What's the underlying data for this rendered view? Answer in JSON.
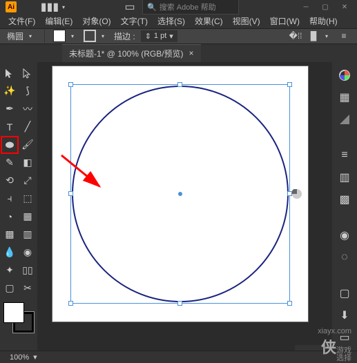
{
  "titlebar": {
    "logo_text": "Ai",
    "search_placeholder": "搜索 Adobe 帮助"
  },
  "menu": {
    "file": "文件(F)",
    "edit": "编辑(E)",
    "object": "对象(O)",
    "type": "文字(T)",
    "select": "选择(S)",
    "effect": "效果(C)",
    "view": "视图(V)",
    "window": "窗口(W)",
    "help": "帮助(H)"
  },
  "control": {
    "shape_label": "椭圆",
    "stroke_label": "描边 :",
    "stroke_value": "1 pt"
  },
  "doc": {
    "tab_title": "未标题-1* @ 100% (RGB/预览)"
  },
  "status": {
    "zoom": "100%",
    "select_hint": "选择"
  },
  "watermark": {
    "site": "xiayx.com",
    "brand_prefix": "侠",
    "brand_suffix": "游戏"
  }
}
